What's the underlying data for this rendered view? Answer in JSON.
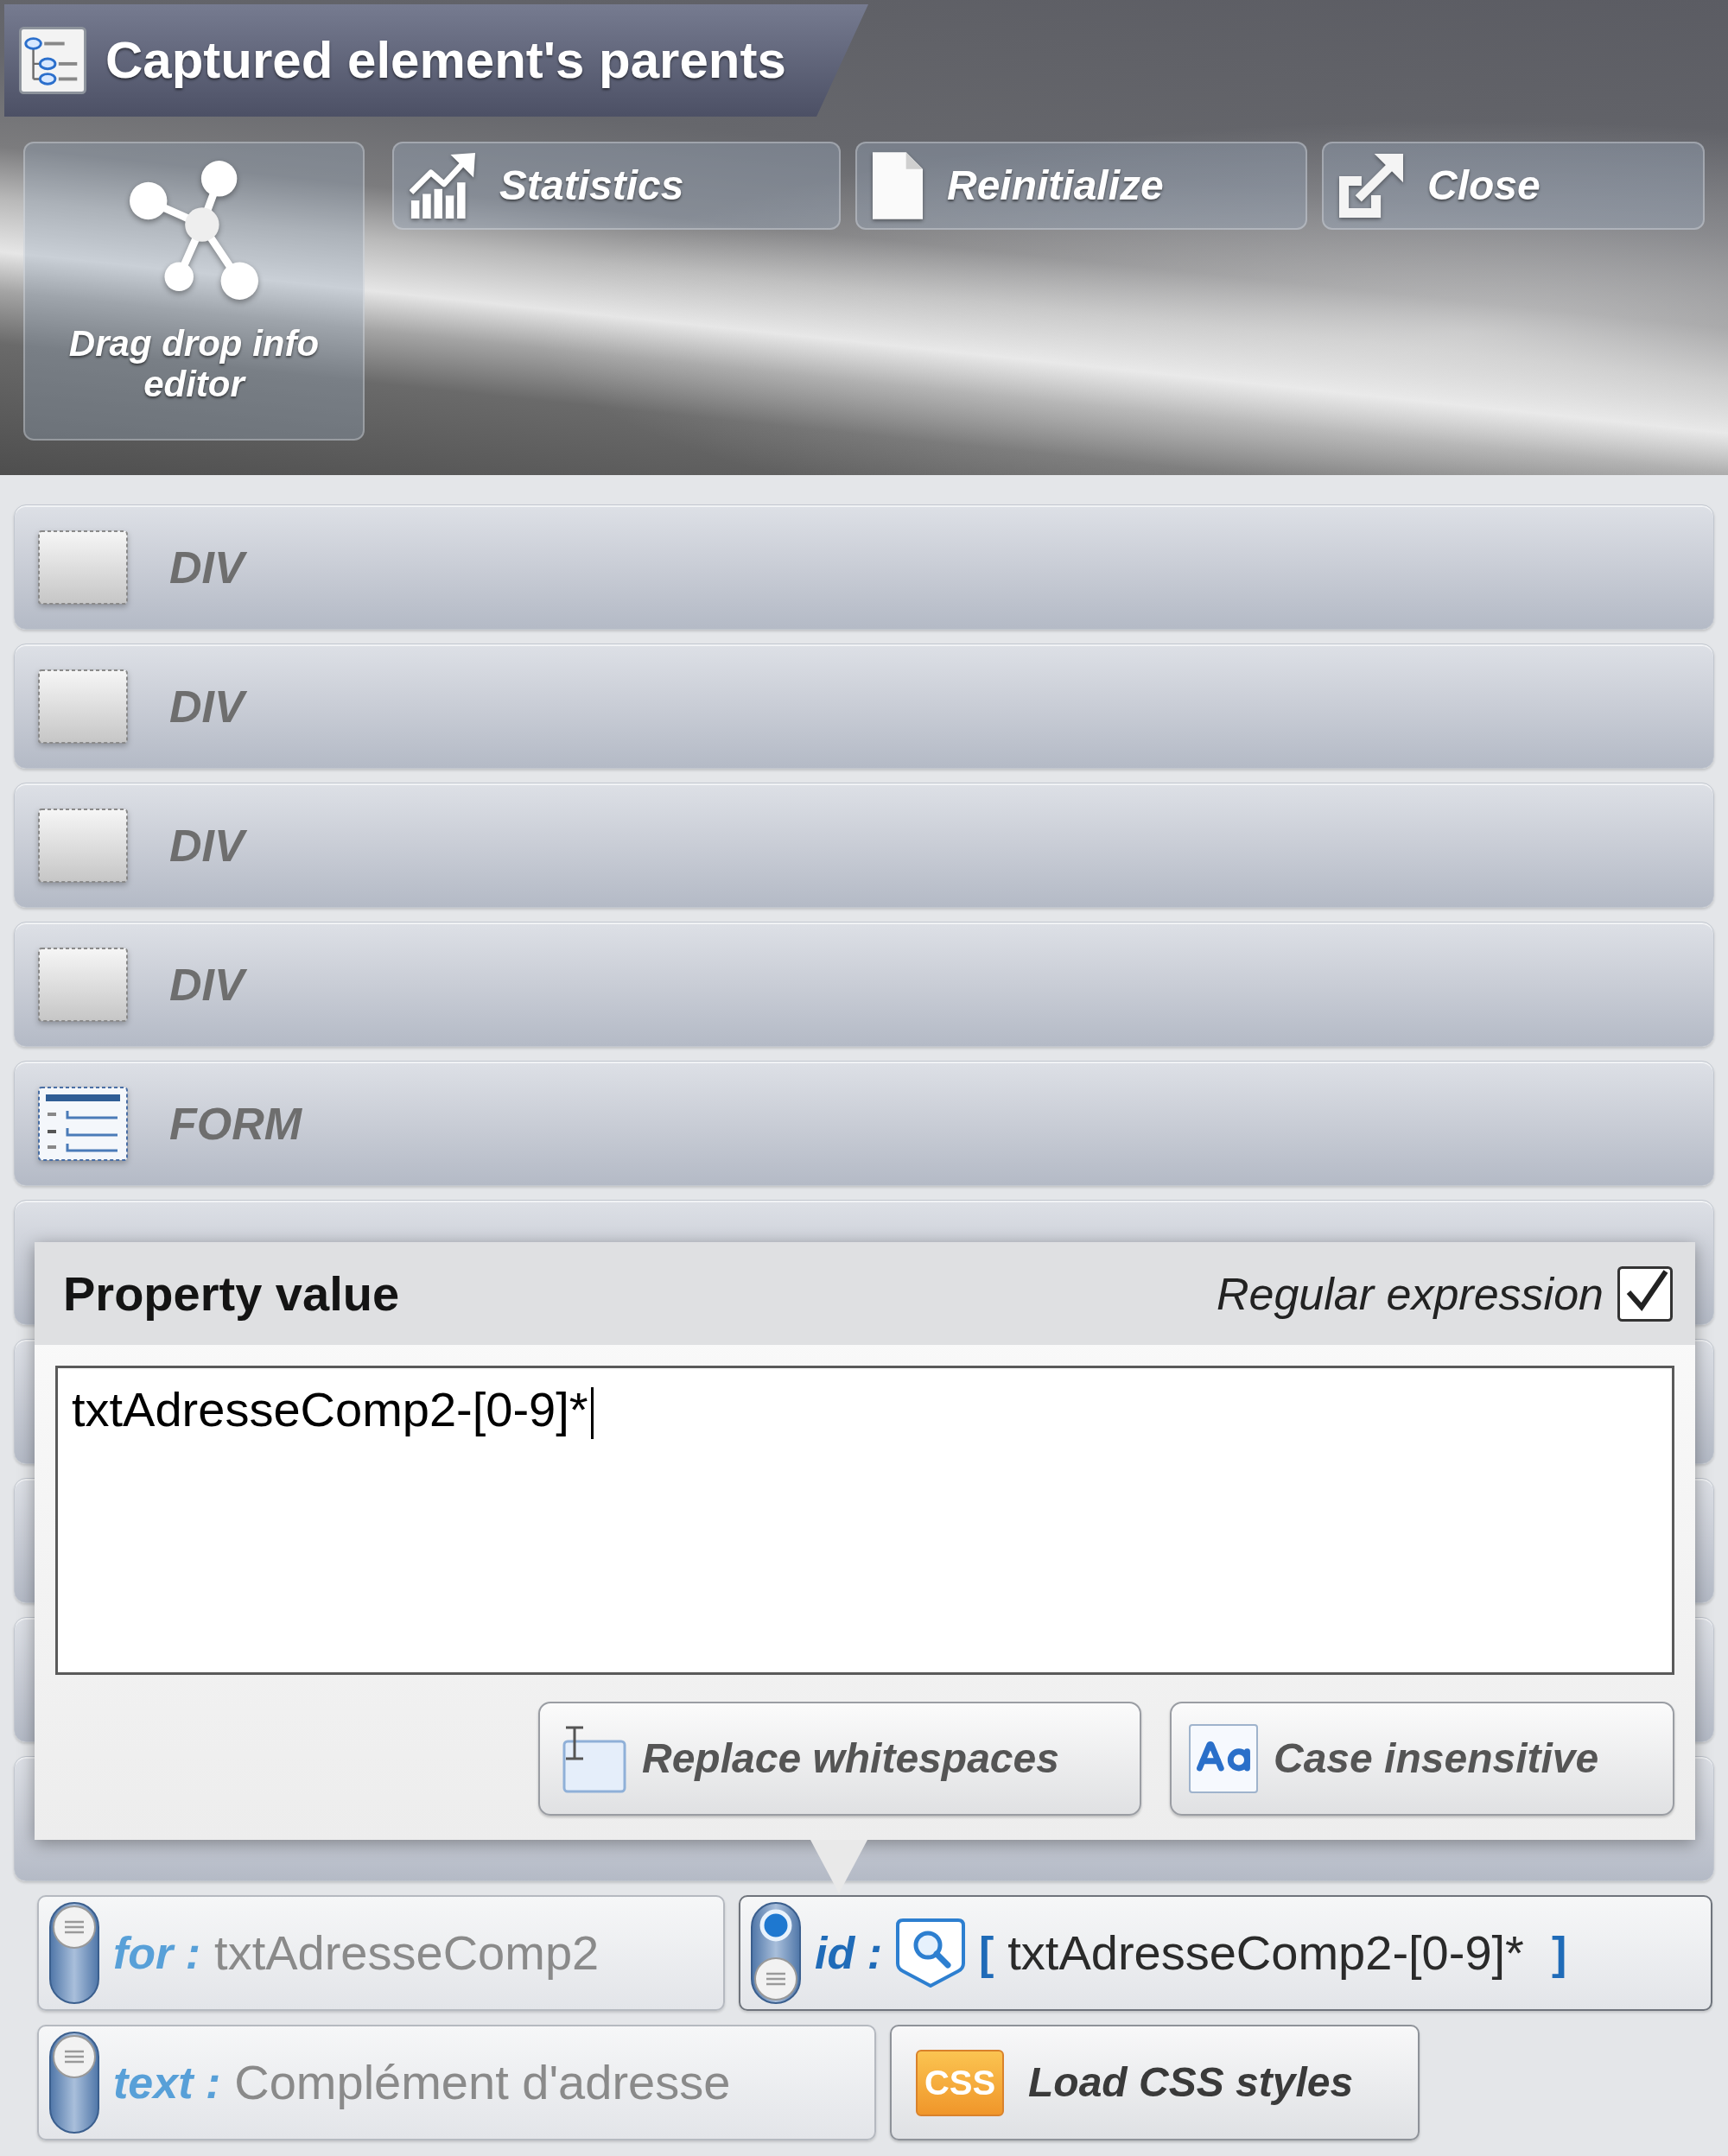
{
  "title": "Captured element's parents",
  "editor_tile": {
    "label": "Drag drop info editor"
  },
  "toolbar": [
    {
      "kind": "statistics",
      "label": "Statistics"
    },
    {
      "kind": "reinitialize",
      "label": "Reinitialize"
    },
    {
      "kind": "close",
      "label": "Close"
    }
  ],
  "rows": [
    {
      "kind": "div",
      "label": "DIV"
    },
    {
      "kind": "div",
      "label": "DIV"
    },
    {
      "kind": "div",
      "label": "DIV"
    },
    {
      "kind": "div",
      "label": "DIV"
    },
    {
      "kind": "form",
      "label": "FORM"
    },
    {
      "kind": "covered"
    },
    {
      "kind": "covered"
    },
    {
      "kind": "covered"
    },
    {
      "kind": "covered"
    },
    {
      "kind": "covered"
    }
  ],
  "popup": {
    "title": "Property value",
    "regex_label": "Regular expression",
    "regex_checked": true,
    "value": "txtAdresseComp2-[0-9]*",
    "focused": true,
    "buttons": [
      {
        "kind": "whitespace",
        "label": "Replace whitespaces"
      },
      {
        "kind": "case",
        "label": "Case insensitive"
      }
    ]
  },
  "attributes": [
    [
      {
        "name": "for :",
        "value": "txtAdresseComp2",
        "on": false,
        "regex": false
      },
      {
        "name": "id :",
        "value": "txtAdresseComp2-[0-9]*",
        "on": true,
        "regex": true,
        "brackets": [
          "[",
          "]"
        ]
      }
    ],
    [
      {
        "name": "text :",
        "value": "Complément d'adresse",
        "on": false,
        "regex": false
      }
    ]
  ],
  "css_button": {
    "badge": "CSS",
    "label": "Load CSS styles"
  }
}
